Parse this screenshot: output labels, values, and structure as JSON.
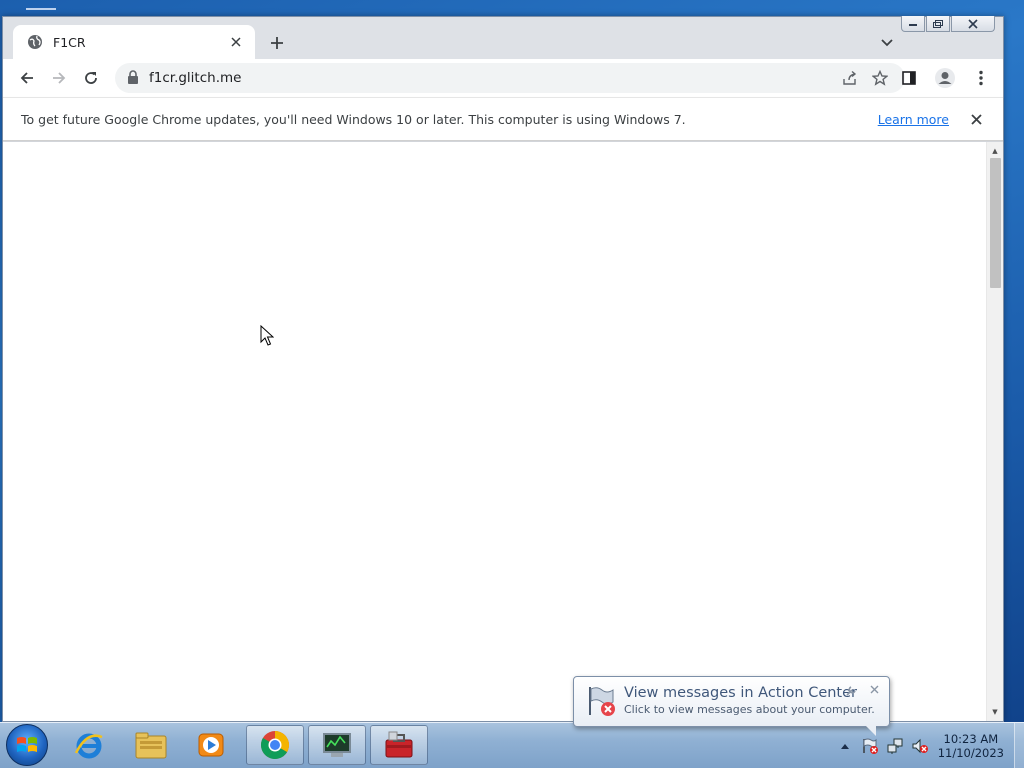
{
  "browser": {
    "tab": {
      "title": "F1CR"
    },
    "address": {
      "url": "f1cr.glitch.me"
    },
    "infobar": {
      "message": "To get future Google Chrome updates, you'll need Windows 10 or later. This computer is using Windows 7.",
      "link": "Learn more"
    }
  },
  "notification": {
    "title": "View messages in Action Center",
    "subtitle": "Click to view messages about your computer."
  },
  "clock": {
    "time": "10:23 AM",
    "date": "11/10/2023"
  },
  "taskbar": {
    "apps": [
      "ie-icon",
      "explorer-icon",
      "media-player-icon",
      "chrome-icon",
      "task-manager-icon",
      "toolbox-icon"
    ]
  },
  "colors": {
    "link": "#1a73e8",
    "tabstrip": "#dee1e6"
  }
}
